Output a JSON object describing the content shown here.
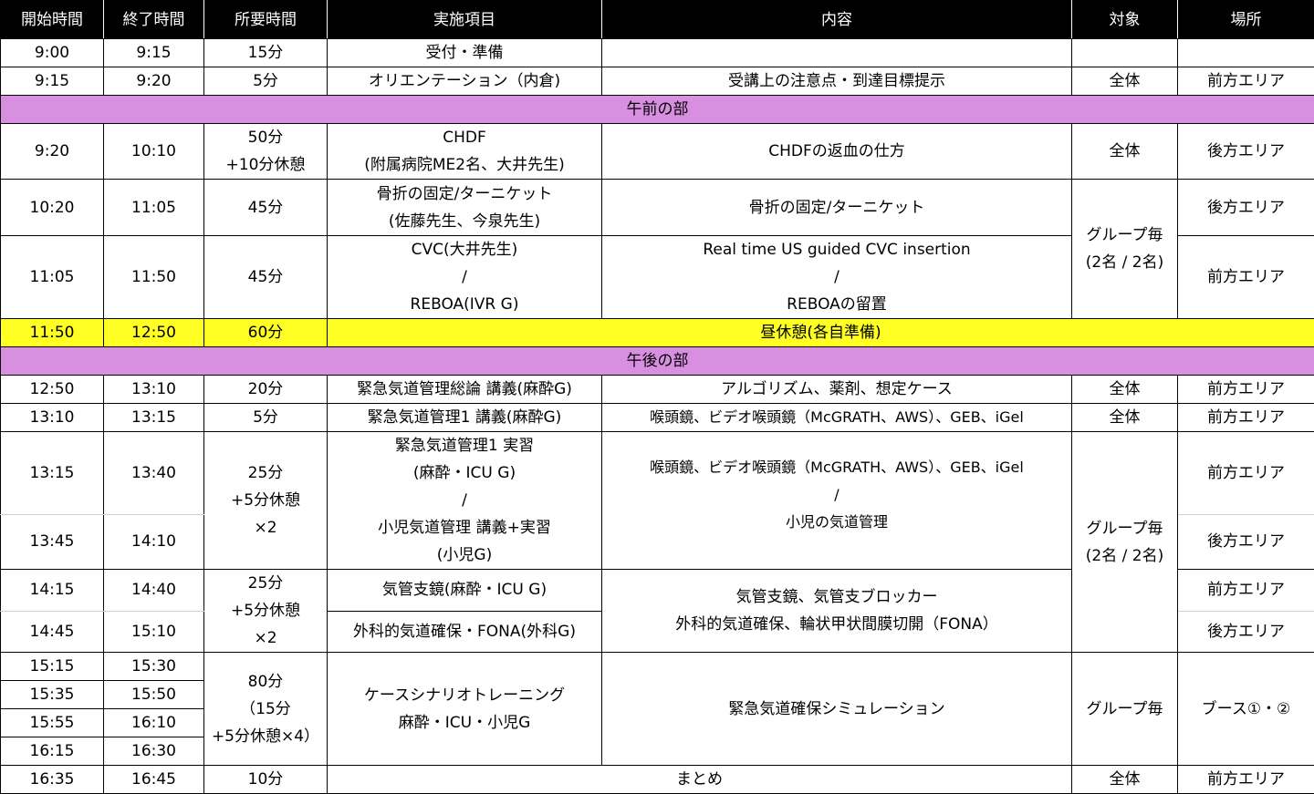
{
  "header": [
    "開始時間",
    "終了時間",
    "所要時間",
    "実施項目",
    "内容",
    "対象",
    "場所"
  ],
  "session_am": "午前の部",
  "session_pm": "午後の部",
  "rows": {
    "r1": {
      "start": "9:00",
      "end": "9:15",
      "dur": "15分",
      "item": "受付・準備"
    },
    "r2": {
      "start": "9:15",
      "end": "9:20",
      "dur": "5分",
      "item": "オリエンテーション（内倉)",
      "content": "受講上の注意点・到達目標提示",
      "target": "全体",
      "place": "前方エリア"
    },
    "r3": {
      "start": "9:20",
      "end": "10:10",
      "dur": [
        "50分",
        "+10分休憩"
      ],
      "item": [
        "CHDF",
        "(附属病院ME2名、大井先生)"
      ],
      "content": "CHDFの返血の仕方",
      "target": "全体",
      "place": "後方エリア"
    },
    "r4": {
      "start": "10:20",
      "end": "11:05",
      "dur": "45分",
      "item": [
        "骨折の固定/ターニケット",
        "(佐藤先生、今泉先生)"
      ],
      "content": "骨折の固定/ターニケット",
      "target": [
        "グループ毎",
        "(2名 / 2名)"
      ],
      "place": "後方エリア"
    },
    "r5": {
      "start": "11:05",
      "end": "11:50",
      "dur": "45分",
      "item": [
        "CVC(大井先生)",
        "/",
        "REBOA(IVR G)"
      ],
      "content": [
        "Real time US guided CVC insertion",
        "/",
        "REBOAの留置"
      ],
      "place": "前方エリア"
    },
    "r6": {
      "start": "11:50",
      "end": "12:50",
      "dur": "60分",
      "content": "昼休憩(各自準備)"
    },
    "r7": {
      "start": "12:50",
      "end": "13:10",
      "dur": "20分",
      "item": "緊急気道管理総論 講義(麻酔G)",
      "content": "アルゴリズム、薬剤、想定ケース",
      "target": "全体",
      "place": "前方エリア"
    },
    "r8": {
      "start": "13:10",
      "end": "13:15",
      "dur": "5分",
      "item": "緊急気道管理1 講義(麻酔G)",
      "content": "喉頭鏡、ビデオ喉頭鏡（McGRATH、AWS）、GEB、iGel",
      "target": "全体",
      "place": "前方エリア"
    },
    "r9": {
      "start": "13:15",
      "end": "13:40",
      "dur": [
        "25分",
        "+5分休憩",
        "×2"
      ],
      "item": [
        "緊急気道管理1 実習",
        "(麻酔・ICU G)",
        "/",
        "小児気道管理 講義+実習",
        "(小児G)"
      ],
      "content": [
        "喉頭鏡、ビデオ喉頭鏡（McGRATH、AWS）、GEB、iGel",
        "/",
        "小児の気道管理"
      ],
      "target": [
        "グループ毎",
        "(2名 / 2名)"
      ],
      "place": "前方エリア"
    },
    "r10": {
      "start": "13:45",
      "end": "14:10",
      "place": "後方エリア"
    },
    "r11": {
      "start": "14:15",
      "end": "14:40",
      "dur": [
        "25分",
        "+5分休憩",
        "×2"
      ],
      "item": "気管支鏡(麻酔・ICU G)",
      "content": [
        "気管支鏡、気管支ブロッカー",
        "外科的気道確保、輪状甲状間膜切開（FONA）"
      ],
      "place": "前方エリア"
    },
    "r12": {
      "start": "14:45",
      "end": "15:10",
      "item": "外科的気道確保・FONA(外科G)",
      "place": "後方エリア"
    },
    "r13": {
      "start": "15:15",
      "end": "15:30",
      "dur": [
        "80分",
        "（15分",
        "+5分休憩×4）"
      ],
      "item": [
        "ケースシナリオトレーニング",
        "麻酔・ICU・小児G"
      ],
      "content": "緊急気道確保シミュレーション",
      "target": "グループ毎",
      "place": "ブース①・②"
    },
    "r14": {
      "start": "15:35",
      "end": "15:50"
    },
    "r15": {
      "start": "15:55",
      "end": "16:10"
    },
    "r16": {
      "start": "16:15",
      "end": "16:30"
    },
    "r17": {
      "start": "16:35",
      "end": "16:45",
      "dur": "10分",
      "content": "まとめ",
      "target": "全体",
      "place": "前方エリア"
    }
  }
}
